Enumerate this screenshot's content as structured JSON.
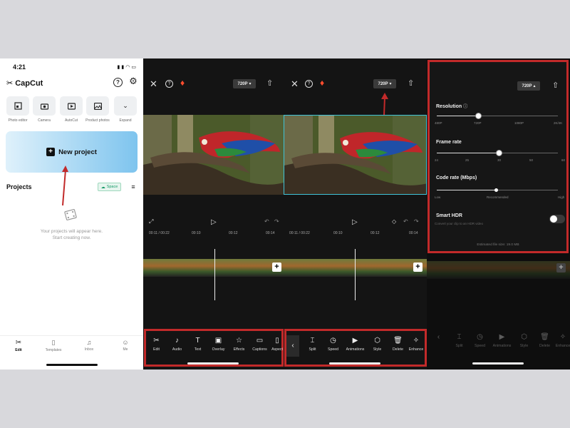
{
  "colors": {
    "annotation_red": "#c22a2a",
    "card_gradient_start": "#dff1fb",
    "card_gradient_end": "#7ec4ee"
  },
  "status_bar": {
    "time": "4:21"
  },
  "capcut": {
    "app_name": "CapCut",
    "quick_actions": [
      {
        "label": "Photo editor",
        "icon": "photo-editor-icon"
      },
      {
        "label": "Camera",
        "icon": "camera-icon"
      },
      {
        "label": "AutoCut",
        "icon": "autocut-icon"
      },
      {
        "label": "Product photos",
        "icon": "product-photos-icon"
      },
      {
        "label": "Expand",
        "icon": "chevron-down-icon"
      }
    ],
    "new_project": "New project",
    "projects_title": "Projects",
    "space_badge": "Space",
    "empty_line1": "Your projects will appear here.",
    "empty_line2": "Start creating now.",
    "nav": [
      {
        "label": "Edit",
        "icon": "scissors-icon"
      },
      {
        "label": "Templates",
        "icon": "templates-icon"
      },
      {
        "label": "Inbox",
        "icon": "bell-icon"
      },
      {
        "label": "Me",
        "icon": "person-icon"
      }
    ]
  },
  "editor": {
    "resolution_button": "720P",
    "timecode_1": "00:11 / 00:22",
    "timecode_2": "00:11 / 00:22",
    "ruler_ticks": [
      "00:10",
      "00:12",
      "00:14"
    ],
    "toolbar_main": [
      "Edit",
      "Audio",
      "Text",
      "Overlay",
      "Effects",
      "Captions",
      "Aspect"
    ],
    "toolbar_clip": [
      "Split",
      "Speed",
      "Animations",
      "Style",
      "Delete",
      "Enhance"
    ]
  },
  "export_settings": {
    "resolution_button": "720P",
    "resolution_label": "Resolution",
    "resolution_ticks": [
      "480P",
      "720P",
      "1080P",
      "2K/4K"
    ],
    "resolution_value": "720P",
    "frame_rate_label": "Frame rate",
    "frame_rate_ticks": [
      "24",
      "25",
      "30",
      "50",
      "60"
    ],
    "frame_rate_value": "30",
    "code_rate_label": "Code rate (Mbps)",
    "code_rate_ticks": [
      "Low",
      "Recommended",
      "High"
    ],
    "code_rate_value": "Recommended",
    "smart_hdr_label": "Smart HDR",
    "smart_hdr_desc": "Convert your clip to an HDR video",
    "smart_hdr_on": false,
    "estimated_size": "Estimated file size: 19.0 MB"
  }
}
